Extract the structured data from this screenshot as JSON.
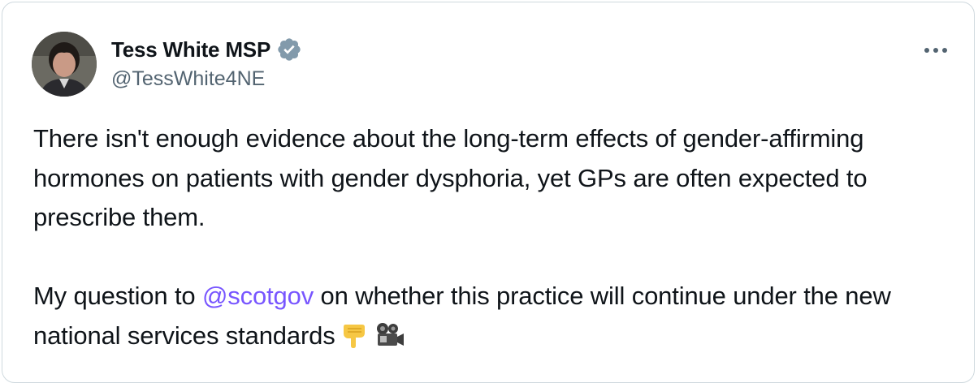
{
  "author": {
    "display_name": "Tess White MSP",
    "handle": "@TessWhite4NE",
    "verified": true
  },
  "tweet": {
    "paragraph1": "There isn't enough evidence about the long-term effects of gender-affirming hormones on patients with gender dysphoria, yet GPs are often expected to prescribe them.",
    "paragraph2_before": "My question to ",
    "mention": "@scotgov",
    "paragraph2_after": " on whether this practice will continue under the new national services standards",
    "emojis": [
      "pointing-down-icon",
      "movie-camera-icon"
    ]
  },
  "colors": {
    "text": "#0f1419",
    "secondary": "#536471",
    "mention": "#7856ff",
    "verified": "#829aab",
    "border": "#cfd9de"
  }
}
